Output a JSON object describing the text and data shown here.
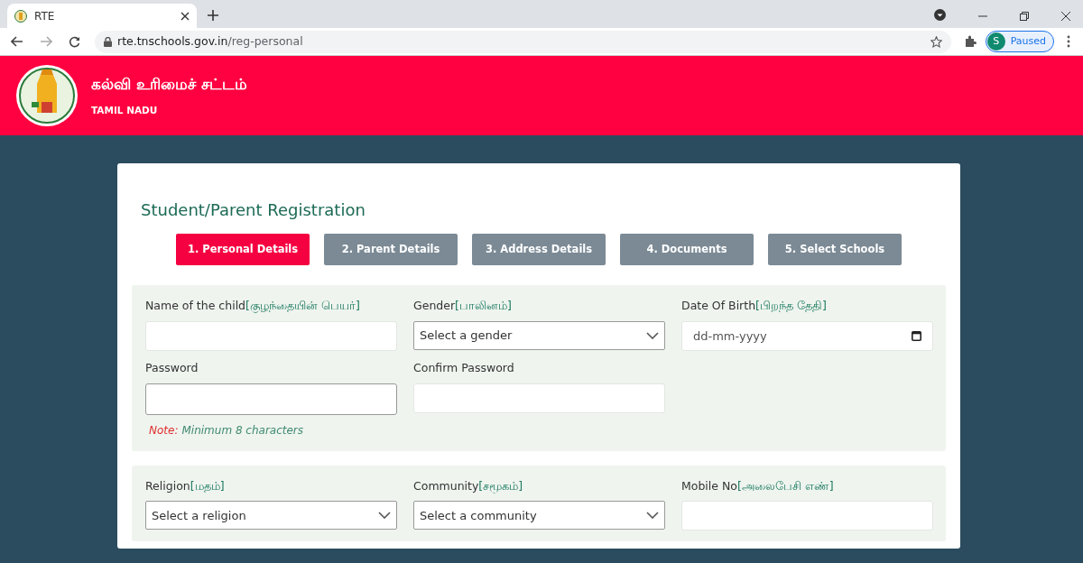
{
  "browser": {
    "tab_title": "RTE",
    "url_host": "rte.tnschools.gov.in",
    "url_path": "/reg-personal",
    "profile_initial": "S",
    "profile_status": "Paused"
  },
  "header": {
    "title": "கல்வி உரிமைச் சட்டம்",
    "subtitle": "TAMIL NADU"
  },
  "page": {
    "title": "Student/Parent Registration"
  },
  "steps": [
    {
      "label": "1. Personal Details",
      "selected": true
    },
    {
      "label": "2. Parent Details",
      "selected": false
    },
    {
      "label": "3. Address Details",
      "selected": false
    },
    {
      "label": "4. Documents",
      "selected": false
    },
    {
      "label": "5. Select Schools",
      "selected": false
    }
  ],
  "sections": [
    {
      "fields": [
        {
          "kind": "text",
          "label": "Name of the child",
          "label_ta": "[குழந்தையின் பெயர்]"
        },
        {
          "kind": "select",
          "label": "Gender",
          "label_ta": "[பாலினம்]",
          "placeholder": "Select a gender"
        },
        {
          "kind": "date",
          "label": "Date Of Birth",
          "label_ta": "[பிறந்த தேதி]",
          "placeholder": "dd-mm-yyyy"
        },
        {
          "kind": "password",
          "label": "Password",
          "note_label": "Note:",
          "note_text": "Minimum 8 characters"
        },
        {
          "kind": "text",
          "label": "Confirm Password"
        }
      ]
    },
    {
      "fields": [
        {
          "kind": "select",
          "label": "Religion",
          "label_ta": "[மதம்]",
          "placeholder": "Select a religion"
        },
        {
          "kind": "select",
          "label": "Community",
          "label_ta": "[சமூகம்]",
          "placeholder": "Select a community"
        },
        {
          "kind": "text",
          "label": "Mobile No",
          "label_ta": "[அலைபேசி எண்]"
        }
      ]
    }
  ]
}
